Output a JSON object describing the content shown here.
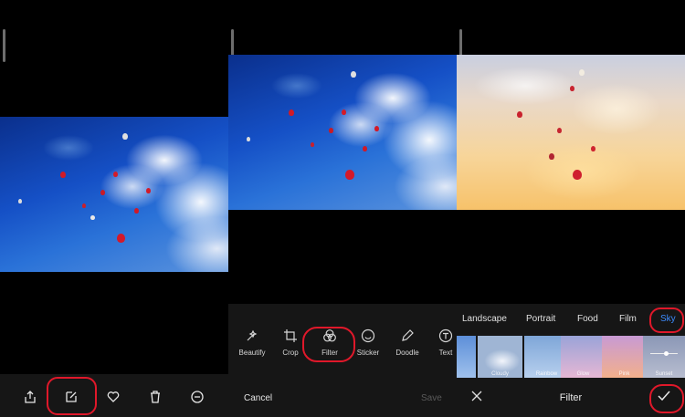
{
  "panel1": {
    "bottom_bar": [
      {
        "icon": "share-icon"
      },
      {
        "icon": "edit-icon"
      },
      {
        "icon": "heart-icon"
      },
      {
        "icon": "trash-icon"
      },
      {
        "icon": "more-icon"
      }
    ]
  },
  "panel2": {
    "tools": [
      {
        "label": "Beautify",
        "icon": "beautify-icon"
      },
      {
        "label": "Crop",
        "icon": "crop-icon"
      },
      {
        "label": "Filter",
        "icon": "filter-icon"
      },
      {
        "label": "Sticker",
        "icon": "sticker-icon"
      },
      {
        "label": "Doodle",
        "icon": "doodle-icon"
      },
      {
        "label": "Text",
        "icon": "text-icon"
      }
    ],
    "cancel_label": "Cancel",
    "save_label": "Save"
  },
  "panel3": {
    "categories": [
      "Landscape",
      "Portrait",
      "Food",
      "Film",
      "Sky"
    ],
    "selected_category": "Sky",
    "filters": [
      {
        "label": "lo"
      },
      {
        "label": "Cloudy"
      },
      {
        "label": "Rainbow"
      },
      {
        "label": "Glow"
      },
      {
        "label": "Pink"
      },
      {
        "label": "Sunset"
      }
    ],
    "title": "Filter"
  },
  "colors": {
    "accent": "#e0182a",
    "toolbar": "#161616",
    "sky_selected": "#3d8cff"
  }
}
